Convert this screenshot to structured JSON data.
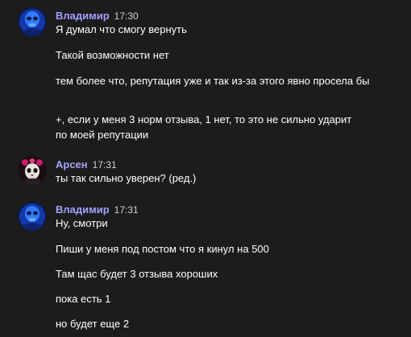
{
  "colors": {
    "background": "#1c1c1c",
    "author_vladimir": "#a4a0ff",
    "author_arsen": "#a9a3f7",
    "timestamp": "#d0d0d0",
    "text": "#ffffff"
  },
  "messages": [
    {
      "author": "Владимир",
      "time": "17:30",
      "avatar": "blue-mask-avatar",
      "lines": [
        "Я думал что смогу вернуть",
        "Такой возможности нет",
        "тем более что, репутация уже и так из-за этого явно просела бы",
        "+, если у меня 3 норм отзыва, 1 нет, то это не сильно ударит по моей репутации"
      ]
    },
    {
      "author": "Арсен",
      "time": "17:31",
      "avatar": "skull-avatar",
      "lines": [
        "ты так сильно уверен? (ред.)"
      ]
    },
    {
      "author": "Владимир",
      "time": "17:31",
      "avatar": "blue-mask-avatar",
      "lines": [
        "Ну, смотри",
        "Пиши у меня под постом что я кинул на 500",
        "Там щас будет 3 отзыва хороших",
        "пока есть 1",
        "но будет еще 2"
      ]
    }
  ]
}
